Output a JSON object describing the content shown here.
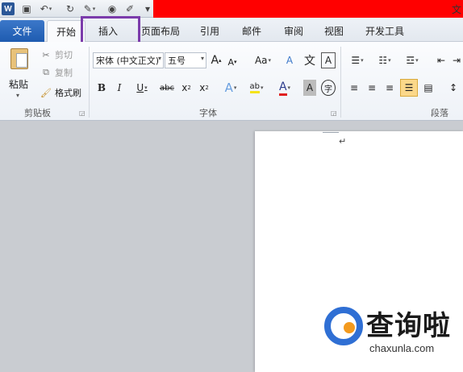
{
  "title_bar": {
    "app_icon_label": "W",
    "title_partial": "文"
  },
  "tabs": {
    "file": "文件",
    "home": "开始",
    "insert": "插入",
    "page_layout": "页面布局",
    "references": "引用",
    "mailings": "邮件",
    "review": "审阅",
    "view": "视图",
    "developer": "开发工具"
  },
  "clipboard": {
    "paste": "粘贴",
    "cut": "剪切",
    "copy": "复制",
    "format_painter": "格式刷",
    "group_label": "剪贴板"
  },
  "font": {
    "font_name": "宋体 (中文正文)",
    "font_size": "五号",
    "grow": "A",
    "shrink": "A",
    "change_case": "Aa",
    "clear_format": "A",
    "pinyin": "文",
    "border": "A",
    "bold": "B",
    "italic": "I",
    "underline": "U",
    "strike": "abc",
    "subscript": "x",
    "superscript": "x",
    "text_effect": "A",
    "highlight": "ab",
    "font_color": "A",
    "shading": "A",
    "enclose": "字",
    "group_label": "字体"
  },
  "paragraph": {
    "group_label": "段落"
  },
  "document": {
    "para_mark": "↵"
  },
  "watermark": {
    "brand": "查询啦",
    "url": "chaxunla.com"
  },
  "colors": {
    "file_tab": "#2b63b8",
    "highlight_box": "#7b3bab",
    "title_red": "#ff0000",
    "logo_blue": "#2f6fd4",
    "logo_orange": "#f39a1e"
  }
}
